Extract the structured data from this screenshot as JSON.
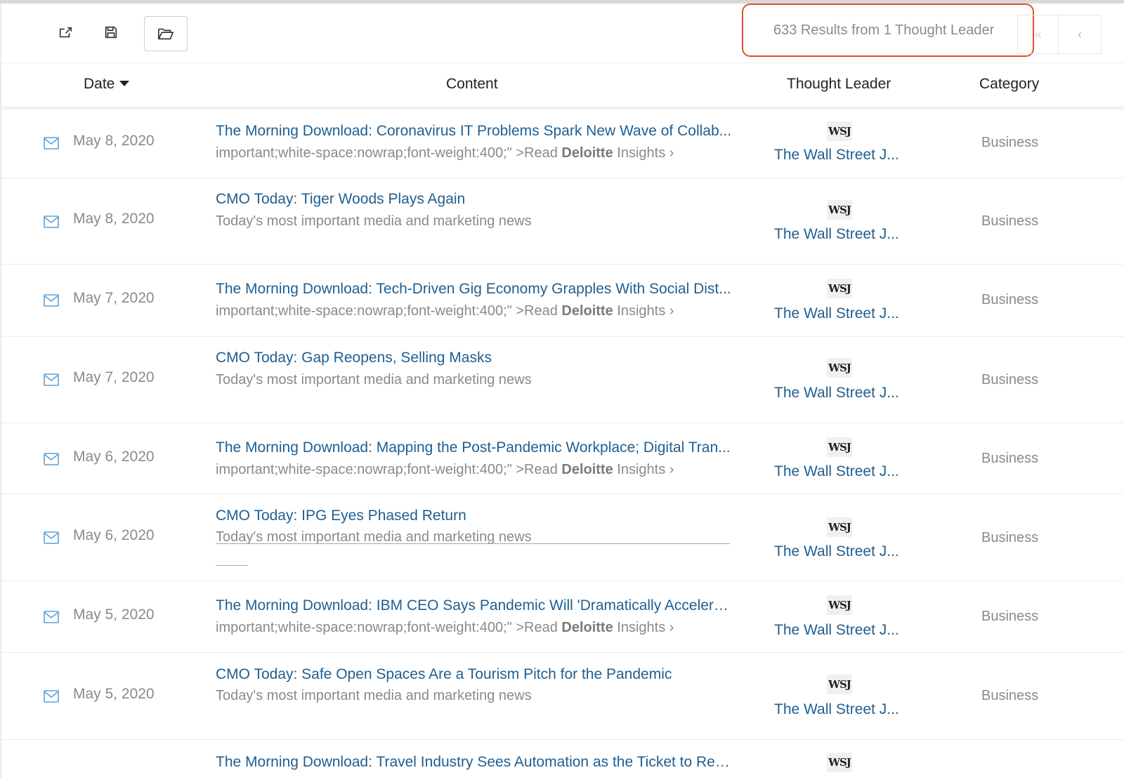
{
  "toolbar": {
    "share_icon": "share-icon",
    "save_icon": "floppy-disk-icon",
    "open_icon": "folder-open-icon"
  },
  "results": {
    "summary": "633 Results from 1 Thought Leader",
    "first_glyph": "«",
    "prev_glyph": "‹"
  },
  "columns": {
    "date": "Date",
    "content": "Content",
    "thought_leader": "Thought Leader",
    "category": "Category"
  },
  "accent_color": "#1f5f91",
  "highlight_color": "#e0502f",
  "rows": [
    {
      "date": "May 8, 2020",
      "title": "The Morning Download: Coronavirus IT Problems Spark New Wave of Collab...",
      "sub_pre": "important;white-space:nowrap;font-weight:400;\" >Read ",
      "sub_bold": "Deloitte",
      "sub_post": " Insights ›",
      "logo": "WSJ",
      "leader": "The Wall Street J...",
      "category": "Business"
    },
    {
      "date": "May 8, 2020",
      "title": "CMO Today: Tiger Woods Plays Again",
      "sub": "Today's most important media and marketing news",
      "logo": "WSJ",
      "leader": "The Wall Street J...",
      "category": "Business"
    },
    {
      "date": "May 7, 2020",
      "title": "The Morning Download: Tech-Driven Gig Economy Grapples With Social Dist...",
      "sub_pre": "important;white-space:nowrap;font-weight:400;\" >Read ",
      "sub_bold": "Deloitte",
      "sub_post": " Insights ›",
      "logo": "WSJ",
      "leader": "The Wall Street J...",
      "category": "Business"
    },
    {
      "date": "May 7, 2020",
      "title": "CMO Today: Gap Reopens, Selling Masks",
      "sub": "Today's most important media and marketing news",
      "logo": "WSJ",
      "leader": "The Wall Street J...",
      "category": "Business"
    },
    {
      "date": "May 6, 2020",
      "title": "The Morning Download: Mapping the Post-Pandemic Workplace; Digital Tran...",
      "sub_pre": "important;white-space:nowrap;font-weight:400;\" >Read ",
      "sub_bold": "Deloitte",
      "sub_post": " Insights ›",
      "logo": "WSJ",
      "leader": "The Wall Street J...",
      "category": "Business"
    },
    {
      "date": "May 6, 2020",
      "title": "CMO Today: IPG Eyes Phased Return",
      "sub": "Today's most important media and marketing news",
      "logo": "WSJ",
      "leader": "The Wall Street J...",
      "category": "Business"
    },
    {
      "date": "May 5, 2020",
      "title": "The Morning Download: IBM CEO Says Pandemic Will 'Dramatically Accelera...",
      "sub_pre": "important;white-space:nowrap;font-weight:400;\" >Read ",
      "sub_bold": "Deloitte",
      "sub_post": " Insights ›",
      "logo": "WSJ",
      "leader": "The Wall Street J...",
      "category": "Business"
    },
    {
      "date": "May 5, 2020",
      "title": "CMO Today: Safe Open Spaces Are a Tourism Pitch for the Pandemic",
      "sub": "Today's most important media and marketing news",
      "logo": "WSJ",
      "leader": "The Wall Street J...",
      "category": "Business"
    },
    {
      "title": "The Morning Download: Travel Industry Sees Automation as the Ticket to Rec...",
      "logo": "WSJ"
    }
  ]
}
